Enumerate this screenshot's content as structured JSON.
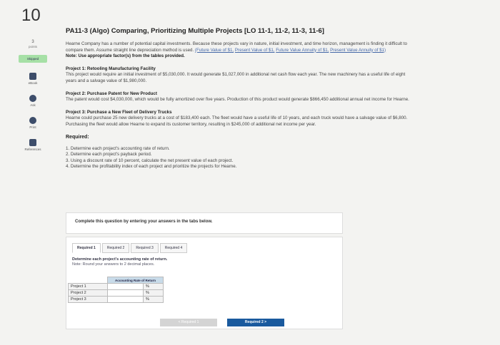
{
  "question": {
    "number": "10",
    "title": "PA11-3 (Algo) Comparing, Prioritizing Multiple Projects [LO 11-1, 11-2, 11-3, 11-6]"
  },
  "sidebar": {
    "points_value": "3",
    "points_label": "points",
    "status": "Skipped",
    "tools": [
      {
        "label": "eBook",
        "icon": "book-icon"
      },
      {
        "label": "Ask",
        "icon": "ask-icon"
      },
      {
        "label": "Print",
        "icon": "print-icon"
      },
      {
        "label": "References",
        "icon": "references-icon"
      }
    ]
  },
  "intro": {
    "text": "Hearne Company has a number of potential capital investments. Because these projects vary in nature, initial investment, and time horizon, management is finding it difficult to compare them. Assume straight line depreciation method is used.",
    "links": [
      "(Future Value of $1,",
      "Present Value of $1,",
      "Future Value Annuity of $1,",
      "Present Value Annuity of $1)"
    ],
    "note": "Note: Use appropriate factor(s) from the tables provided."
  },
  "projects": [
    {
      "title": "Project 1: Retooling Manufacturing Facility",
      "text": "This project would require an initial investment of $5,030,000. It would generate $1,027,000 in additional net cash flow each year. The new machinery has a useful life of eight years and a salvage value of $1,980,000."
    },
    {
      "title": "Project 2: Purchase Patent for New Product",
      "text": "The patent would cost $4,030,000, which would be fully amortized over five years. Production of this product would generate $866,450 additional annual net income for Hearne."
    },
    {
      "title": "Project 3: Purchase a New Fleet of Delivery Trucks",
      "text": "Hearne could purchase 25 new delivery trucks at a cost of $183,400 each. The fleet would have a useful life of 10 years, and each truck would have a salvage value of $6,800. Purchasing the fleet would allow Hearne to expand its customer territory, resulting in $245,000 of additional net income per year."
    }
  ],
  "required": {
    "heading": "Required:",
    "items": [
      "1. Determine each project's accounting rate of return.",
      "2. Determine each project's payback period.",
      "3. Using a discount rate of 10 percent, calculate the net present value of each project.",
      "4. Determine the profitability index of each project and prioritize the projects for Hearne."
    ]
  },
  "instruction_card": "Complete this question by entering your answers in the tabs below.",
  "tabs": [
    "Required 1",
    "Required 2",
    "Required 3",
    "Required 4"
  ],
  "active_tab": "Required 1",
  "tab_content": {
    "prompt": "Determine each project's accounting rate of return.",
    "note": "Note: Round your answers to 2 decimal places.",
    "column_header": "Accounting Rate of Return",
    "rows": [
      {
        "label": "Project 1",
        "value": "",
        "unit": "%"
      },
      {
        "label": "Project 2",
        "value": "",
        "unit": "%"
      },
      {
        "label": "Project 3",
        "value": "",
        "unit": "%"
      }
    ]
  },
  "nav": {
    "prev_label": "< Required 1",
    "next_label": "Required 2 >"
  },
  "colors": {
    "accent": "#1a5a9e",
    "skipped_badge": "#a6e0a6",
    "table_header": "#c8dbe9"
  }
}
